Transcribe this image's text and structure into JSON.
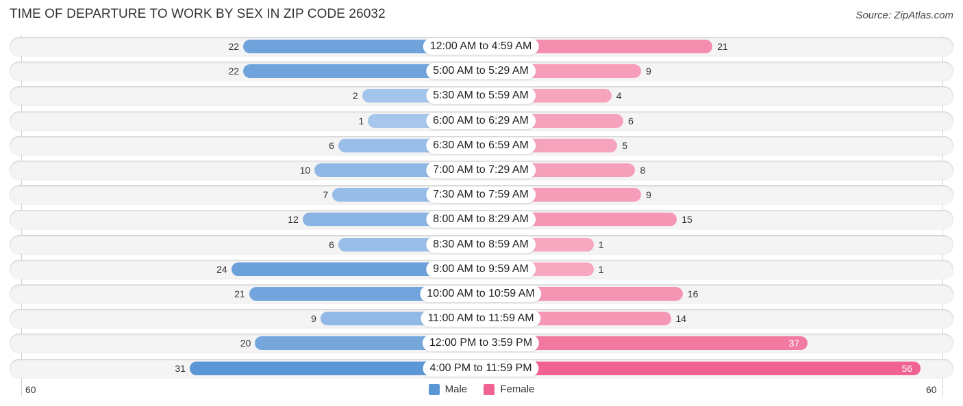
{
  "title": "TIME OF DEPARTURE TO WORK BY SEX IN ZIP CODE 26032",
  "source": "Source: ZipAtlas.com",
  "colors": {
    "male_dark": "#5b96d6",
    "male_light": "#a9c8ec",
    "female_dark": "#f0628f",
    "female_light": "#f7a9c1"
  },
  "chart_data": {
    "type": "bar",
    "orientation": "horizontal-diverging",
    "title": "TIME OF DEPARTURE TO WORK BY SEX IN ZIP CODE 26032",
    "categories": [
      "12:00 AM to 4:59 AM",
      "5:00 AM to 5:29 AM",
      "5:30 AM to 5:59 AM",
      "6:00 AM to 6:29 AM",
      "6:30 AM to 6:59 AM",
      "7:00 AM to 7:29 AM",
      "7:30 AM to 7:59 AM",
      "8:00 AM to 8:29 AM",
      "8:30 AM to 8:59 AM",
      "9:00 AM to 9:59 AM",
      "10:00 AM to 10:59 AM",
      "11:00 AM to 11:59 AM",
      "12:00 PM to 3:59 PM",
      "4:00 PM to 11:59 PM"
    ],
    "series": [
      {
        "name": "Male",
        "values": [
          22,
          22,
          2,
          1,
          6,
          10,
          7,
          12,
          6,
          24,
          21,
          9,
          20,
          31
        ]
      },
      {
        "name": "Female",
        "values": [
          21,
          9,
          4,
          6,
          5,
          8,
          9,
          15,
          1,
          1,
          16,
          14,
          37,
          56
        ]
      }
    ],
    "axis": {
      "left_label": "60",
      "right_label": "60",
      "max": 60
    },
    "legend": {
      "position": "bottom-center",
      "items": [
        "Male",
        "Female"
      ]
    },
    "xlabel": "",
    "ylabel": ""
  }
}
